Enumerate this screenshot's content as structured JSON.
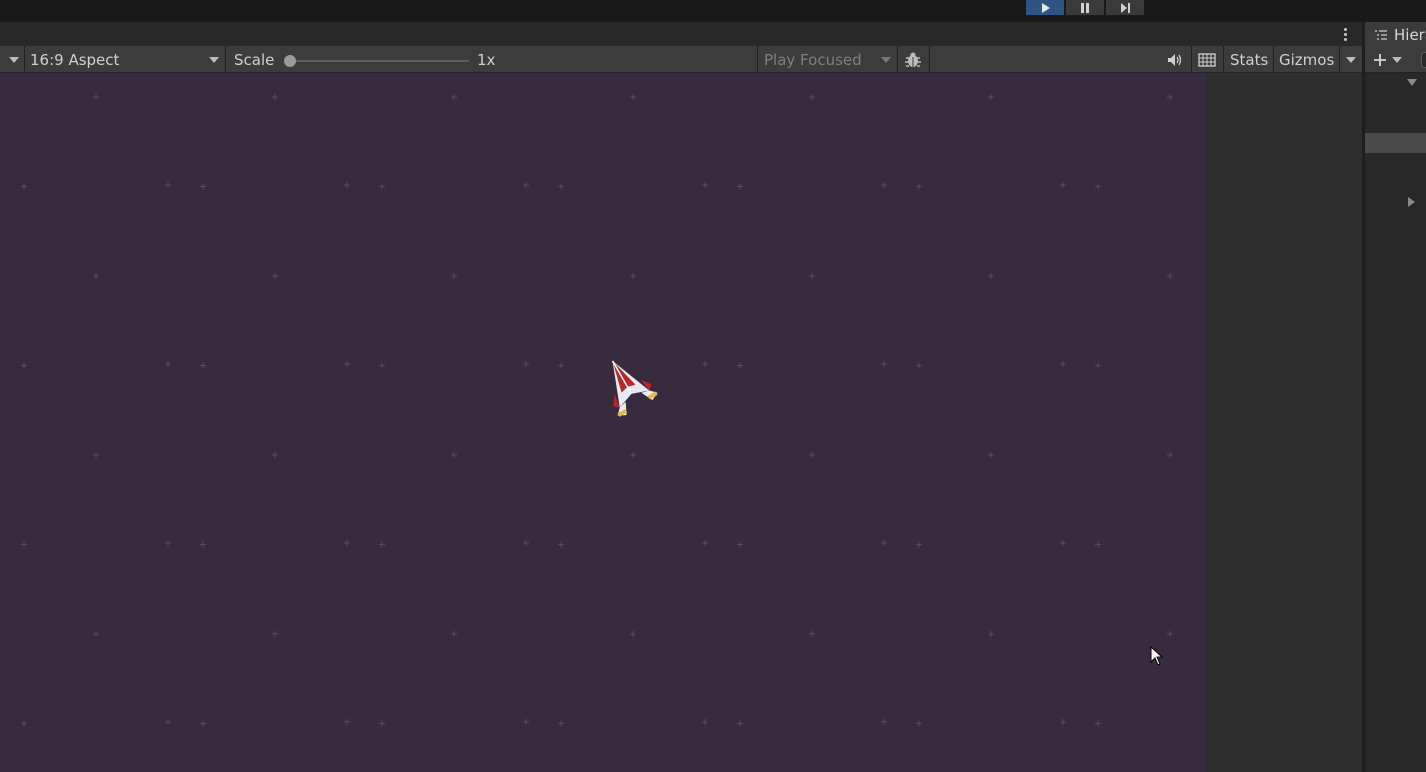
{
  "playbar": {
    "buttons": [
      {
        "name": "play",
        "active": true
      },
      {
        "name": "pause",
        "active": false
      },
      {
        "name": "step",
        "active": false
      }
    ]
  },
  "toolbar": {
    "aspect_label": "16:9 Aspect",
    "scale_label": "Scale",
    "scale_value": "1x",
    "scale_slider_fraction": 0.0,
    "play_mode_label": "Play Focused",
    "stats_label": "Stats",
    "gizmos_label": "Gizmos"
  },
  "hierarchy": {
    "tab_label": "Hiera"
  },
  "colors": {
    "play_active": "#2e5482",
    "viewport_bg": "#3a2a3f",
    "panel_bg": "#282828",
    "toolbar_bg": "#3c3c3c"
  },
  "icons": [
    "play-icon",
    "pause-icon",
    "step-icon",
    "kebab-menu-icon",
    "dropdown-caret-icon",
    "bug-icon",
    "speaker-icon",
    "grid-icon",
    "hierarchy-list-icon",
    "plus-icon",
    "spaceship-sprite",
    "mouse-cursor-icon"
  ]
}
